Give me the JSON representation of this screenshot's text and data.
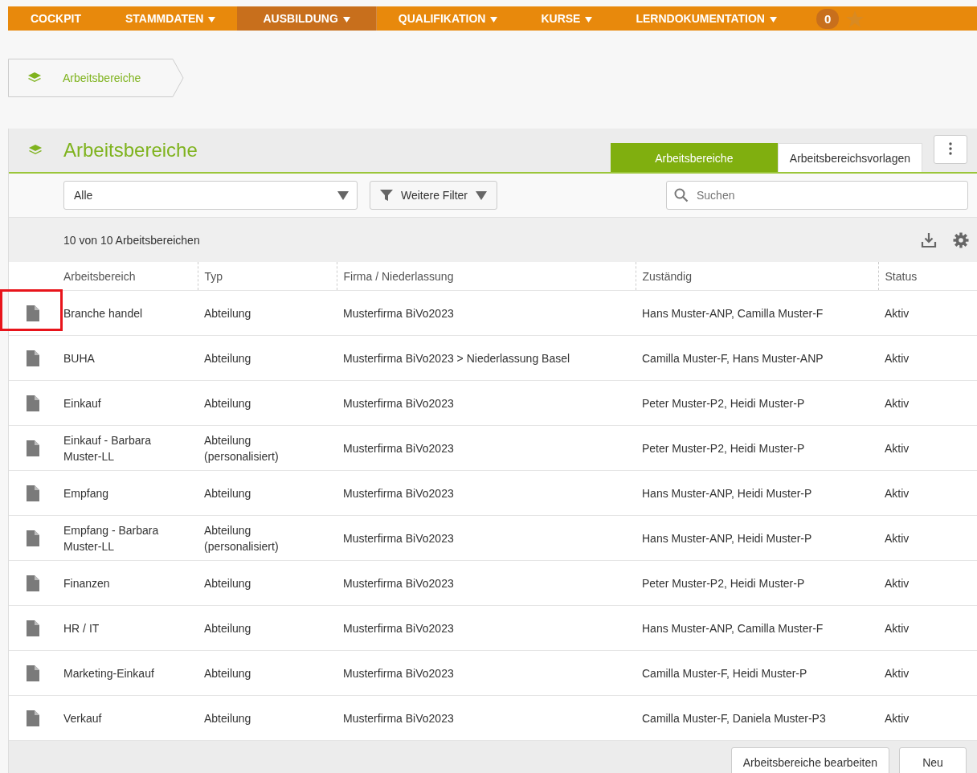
{
  "nav": {
    "items": [
      {
        "label": "COCKPIT",
        "dropdown": false,
        "selected": false
      },
      {
        "label": "STAMMDATEN",
        "dropdown": true,
        "selected": false
      },
      {
        "label": "AUSBILDUNG",
        "dropdown": true,
        "selected": true
      },
      {
        "label": "QUALIFIKATION",
        "dropdown": true,
        "selected": false
      },
      {
        "label": "KURSE",
        "dropdown": true,
        "selected": false
      },
      {
        "label": "LERNDOKUMENTATION",
        "dropdown": true,
        "selected": false
      }
    ],
    "badge": "0"
  },
  "breadcrumb": {
    "label": "Arbeitsbereiche"
  },
  "panel": {
    "title": "Arbeitsbereiche",
    "tabs": [
      {
        "label": "Arbeitsbereiche",
        "selected": true
      },
      {
        "label": "Arbeitsbereichsvorlagen",
        "selected": false
      }
    ],
    "filter_select": {
      "value": "Alle"
    },
    "filter_button": {
      "label": "Weitere Filter"
    },
    "search": {
      "placeholder": "Suchen"
    },
    "count": "10 von 10 Arbeitsbereichen"
  },
  "table": {
    "columns": [
      "Arbeitsbereich",
      "Typ",
      "Firma / Niederlassung",
      "Zuständig",
      "Status"
    ],
    "rows": [
      {
        "cells": [
          "Branche handel",
          "Abteilung",
          "Musterfirma BiVo2023",
          "Hans Muster-ANP, Camilla Muster-F",
          "Aktiv"
        ],
        "highlighted": true
      },
      {
        "cells": [
          "BUHA",
          "Abteilung",
          "Musterfirma BiVo2023 > Niederlassung Basel",
          "Camilla Muster-F, Hans Muster-ANP",
          "Aktiv"
        ],
        "highlighted": false
      },
      {
        "cells": [
          "Einkauf",
          "Abteilung",
          "Musterfirma BiVo2023",
          "Peter Muster-P2, Heidi Muster-P",
          "Aktiv"
        ],
        "highlighted": false
      },
      {
        "cells": [
          "Einkauf - Barbara Muster-LL",
          "Abteilung (personalisiert)",
          "Musterfirma BiVo2023",
          "Peter Muster-P2, Heidi Muster-P",
          "Aktiv"
        ],
        "highlighted": false
      },
      {
        "cells": [
          "Empfang",
          "Abteilung",
          "Musterfirma BiVo2023",
          "Hans Muster-ANP, Heidi Muster-P",
          "Aktiv"
        ],
        "highlighted": false
      },
      {
        "cells": [
          "Empfang - Barbara Muster-LL",
          "Abteilung (personalisiert)",
          "Musterfirma BiVo2023",
          "Hans Muster-ANP, Heidi Muster-P",
          "Aktiv"
        ],
        "highlighted": false
      },
      {
        "cells": [
          "Finanzen",
          "Abteilung",
          "Musterfirma BiVo2023",
          "Peter Muster-P2, Heidi Muster-P",
          "Aktiv"
        ],
        "highlighted": false
      },
      {
        "cells": [
          "HR / IT",
          "Abteilung",
          "Musterfirma BiVo2023",
          "Hans Muster-ANP, Camilla Muster-F",
          "Aktiv"
        ],
        "highlighted": false
      },
      {
        "cells": [
          "Marketing-Einkauf",
          "Abteilung",
          "Musterfirma BiVo2023",
          "Camilla Muster-F, Heidi Muster-P",
          "Aktiv"
        ],
        "highlighted": false
      },
      {
        "cells": [
          "Verkauf",
          "Abteilung",
          "Musterfirma BiVo2023",
          "Camilla Muster-F, Daniela Muster-P3",
          "Aktiv"
        ],
        "highlighted": false
      }
    ]
  },
  "footer": {
    "buttons": [
      "Arbeitsbereiche bearbeiten",
      "Neu"
    ]
  }
}
